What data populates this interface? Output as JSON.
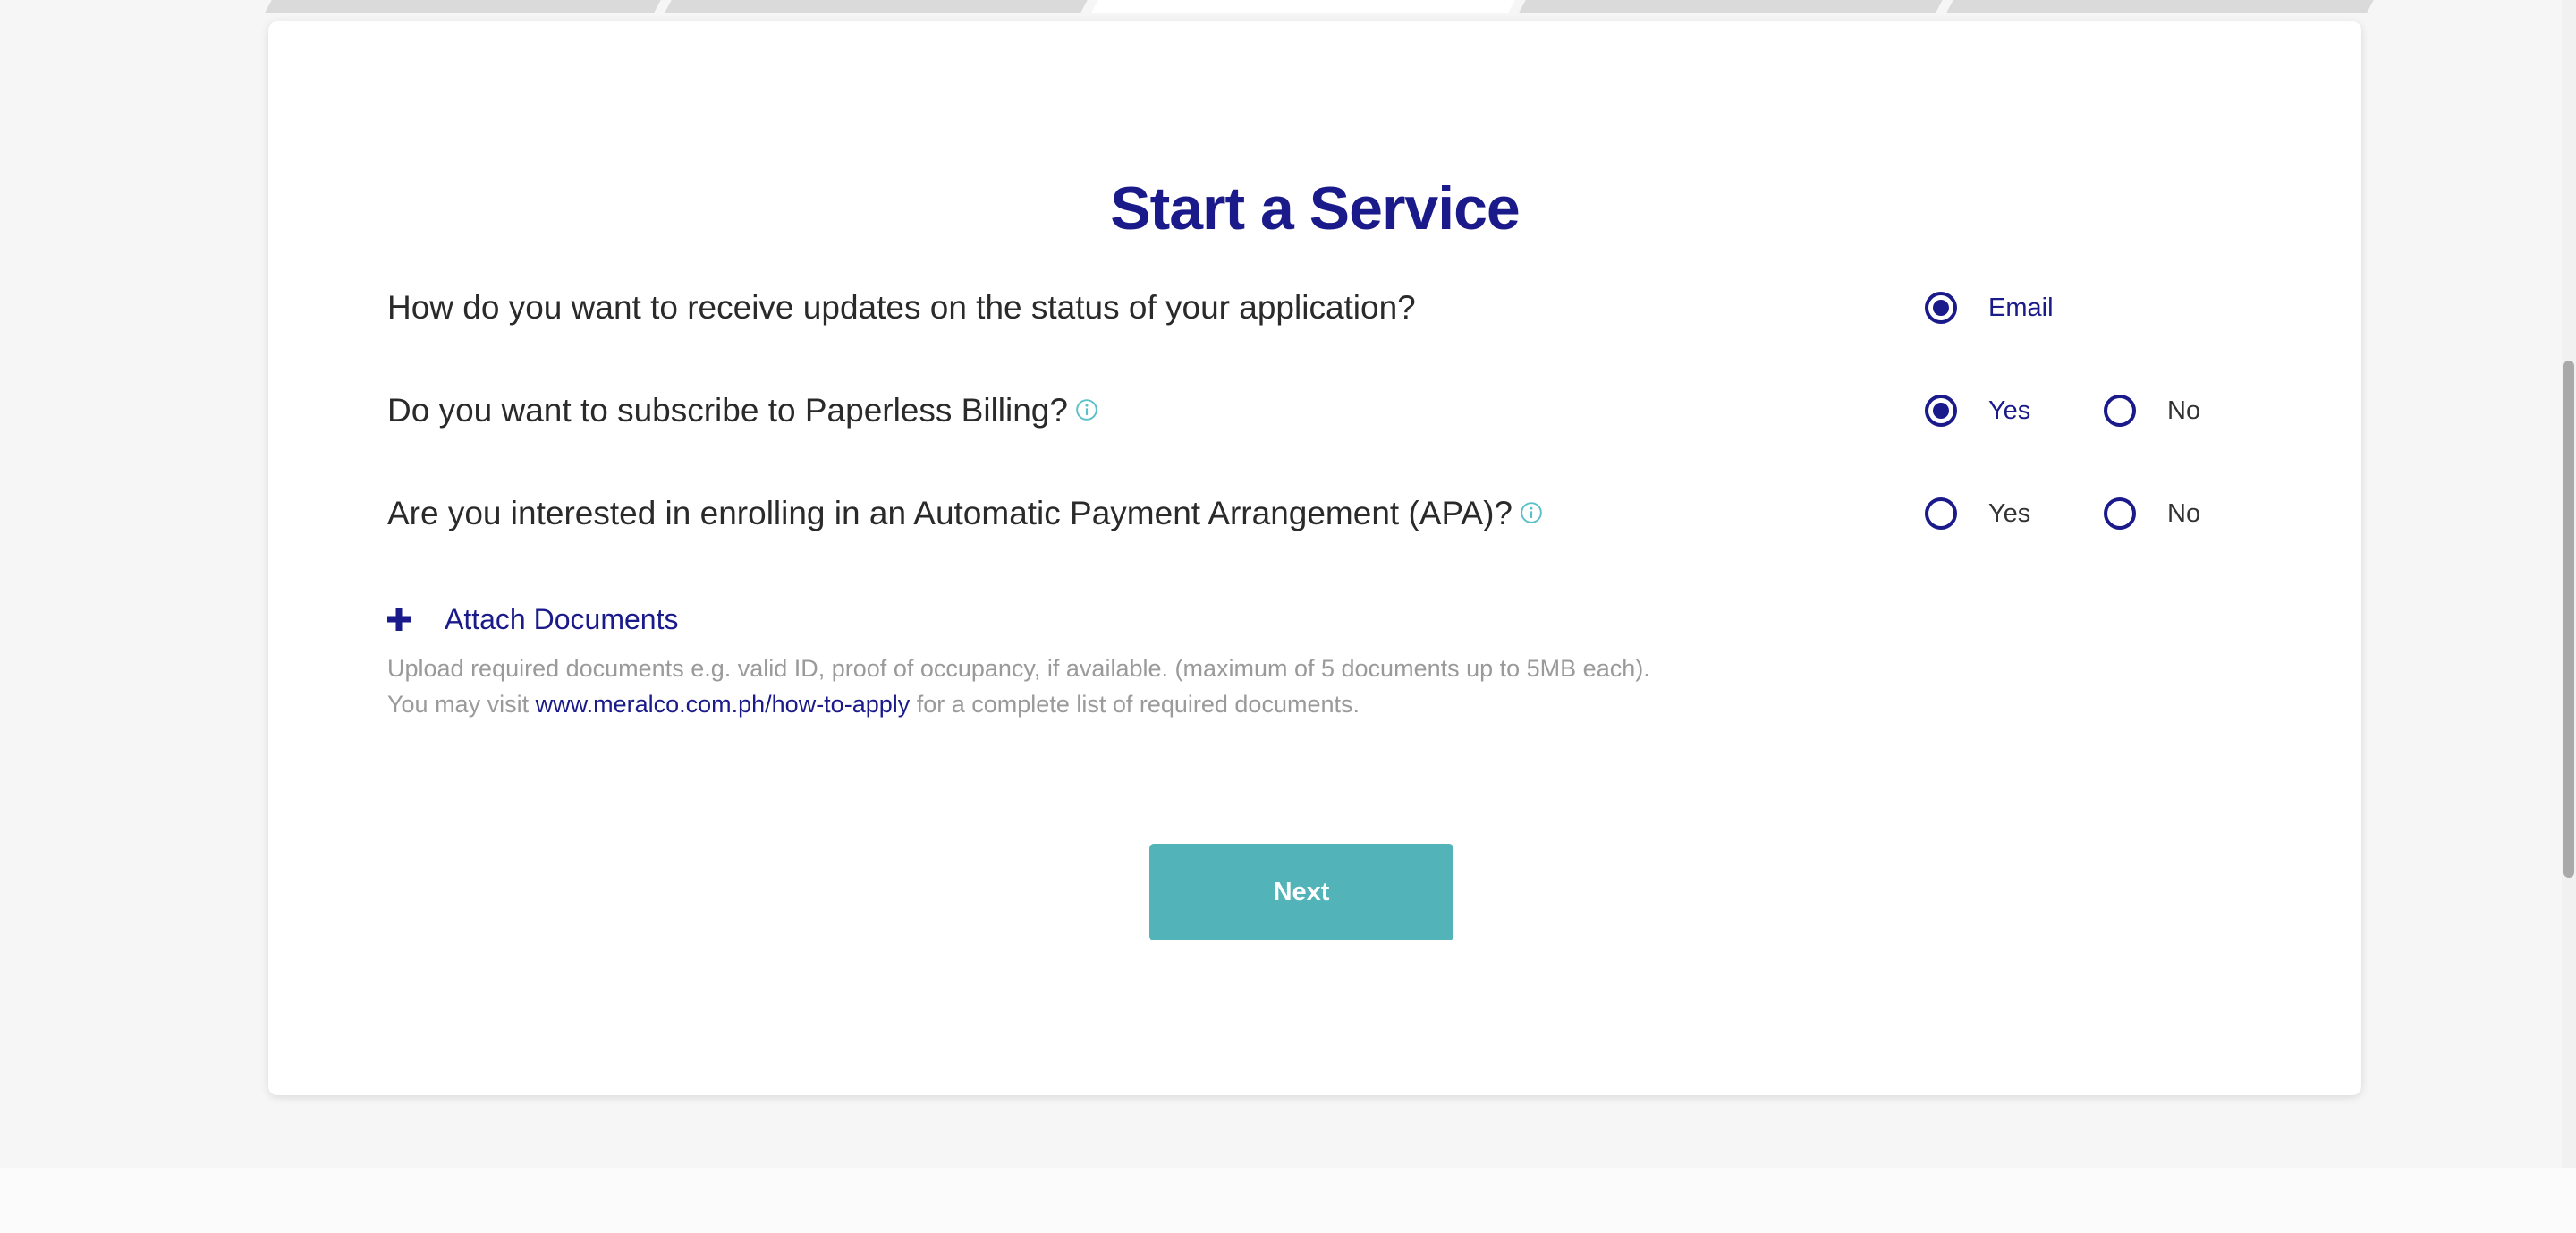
{
  "title": "Start a Service",
  "questions": [
    {
      "text": "How do you want to receive updates on the status of your application?",
      "options": [
        {
          "label": "Email",
          "selected": true
        }
      ]
    },
    {
      "text": "Do you want to subscribe to Paperless Billing?",
      "has_info": true,
      "options": [
        {
          "label": "Yes",
          "selected": true
        },
        {
          "label": "No",
          "selected": false
        }
      ]
    },
    {
      "text": "Are you interested in enrolling in an Automatic Payment Arrangement (APA)?",
      "has_info": true,
      "options": [
        {
          "label": "Yes",
          "selected": false
        },
        {
          "label": "No",
          "selected": false
        }
      ]
    }
  ],
  "attach": {
    "label": "Attach Documents",
    "help_line1": "Upload required documents e.g. valid ID, proof of occupancy, if available. (maximum of 5 documents up to 5MB each).",
    "help_line2_prefix": "You may visit ",
    "help_link": "www.meralco.com.ph/how-to-apply",
    "help_line2_suffix": " for a complete list of required documents."
  },
  "next_label": "Next",
  "colors": {
    "primary": "#1a1a8a",
    "accent_teal": "#52b3b8",
    "info_icon": "#5bc0c8",
    "muted_text": "#9a9a9a"
  },
  "icons": [
    "info-icon",
    "plus-icon"
  ]
}
